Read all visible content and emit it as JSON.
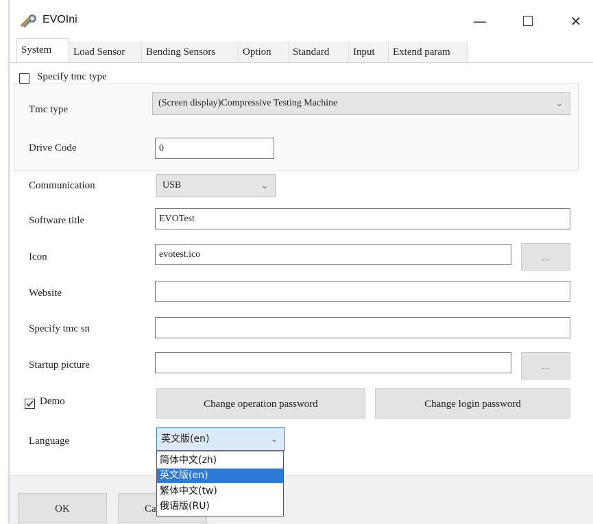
{
  "window": {
    "title": "EVOIni",
    "minimize_glyph": "—",
    "maximize_glyph": "☐",
    "close_glyph": "✕"
  },
  "tabs": [
    "System",
    "Load Sensor",
    "Bending Sensors",
    "Option",
    "Standard",
    "Input",
    "Extend param"
  ],
  "active_tab": "System",
  "system": {
    "specify_tmc_type_label": "Specify tmc type",
    "specify_tmc_type_checked": false,
    "tmc_type_label": "Tmc type",
    "tmc_type_value": "(Screen display)Compressive Testing Machine",
    "drive_code_label": "Drive Code",
    "drive_code_value": "0",
    "communication_label": "Communication",
    "communication_value": "USB",
    "software_title_label": "Software title",
    "software_title_value": "EVOTest",
    "icon_label": "Icon",
    "icon_value": "evotest.ico",
    "browse_label": "...",
    "website_label": "Website",
    "website_value": "",
    "specify_tmc_sn_label": "Specify tmc sn",
    "specify_tmc_sn_value": "",
    "startup_picture_label": "Startup picture",
    "startup_picture_value": "",
    "demo_label": "Demo",
    "demo_checked": true,
    "change_operation_password_label": "Change operation password",
    "change_login_password_label": "Change login password",
    "language_label": "Language",
    "language_value": "英文版(en)",
    "language_options": [
      "简体中文(zh)",
      "英文版(en)",
      "繁体中文(tw)",
      "俄语版(RU)"
    ],
    "language_selected_index": 1
  },
  "footer": {
    "ok_label": "OK",
    "cancel_label_visible": "Ca"
  },
  "icons": {
    "app": "tools-icon",
    "checkbox_checked": "check-icon",
    "dropdown": "chevron-down-icon"
  },
  "colors": {
    "selection": "#2e7ad7",
    "combo_focus_border": "#3c7fd1",
    "button_face": "#e3e3e3"
  }
}
